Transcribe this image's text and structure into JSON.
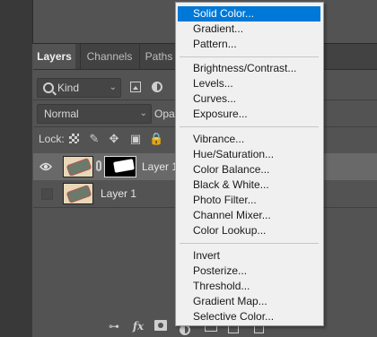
{
  "panel": {
    "tabs": [
      {
        "label": "Layers",
        "active": true
      },
      {
        "label": "Channels",
        "active": false
      },
      {
        "label": "Paths",
        "active": false
      }
    ],
    "filter": {
      "kind_label": "Kind"
    },
    "blend_mode": "Normal",
    "opacity_label": "Opa",
    "lock_label": "Lock:",
    "layers": [
      {
        "name": "Layer 1",
        "visible": true,
        "selected": true,
        "has_mask": true
      },
      {
        "name": "Layer 1",
        "visible": false,
        "selected": false,
        "has_mask": false
      }
    ],
    "bottom_toolbar": {
      "fx_label": "fx",
      "link_glyph": "⊶"
    }
  },
  "menu": {
    "groups": [
      [
        "Solid Color...",
        "Gradient...",
        "Pattern..."
      ],
      [
        "Brightness/Contrast...",
        "Levels...",
        "Curves...",
        "Exposure..."
      ],
      [
        "Vibrance...",
        "Hue/Saturation...",
        "Color Balance...",
        "Black & White...",
        "Photo Filter...",
        "Channel Mixer...",
        "Color Lookup..."
      ],
      [
        "Invert",
        "Posterize...",
        "Threshold...",
        "Gradient Map...",
        "Selective Color..."
      ]
    ],
    "highlighted": "Solid Color...",
    "highlight_color": "#0078d7"
  },
  "colors": {
    "workspace": "#535353",
    "tab_bar": "#424242",
    "selected_row": "#696969",
    "menu_bg": "#f0f0f0"
  },
  "icons": {
    "kind_search": "search-icon",
    "pixel_filter": "image-filter-icon",
    "adjustment_filter": "adjustment-filter-icon",
    "visibility": "eye-icon",
    "link": "chain-link-icon"
  }
}
